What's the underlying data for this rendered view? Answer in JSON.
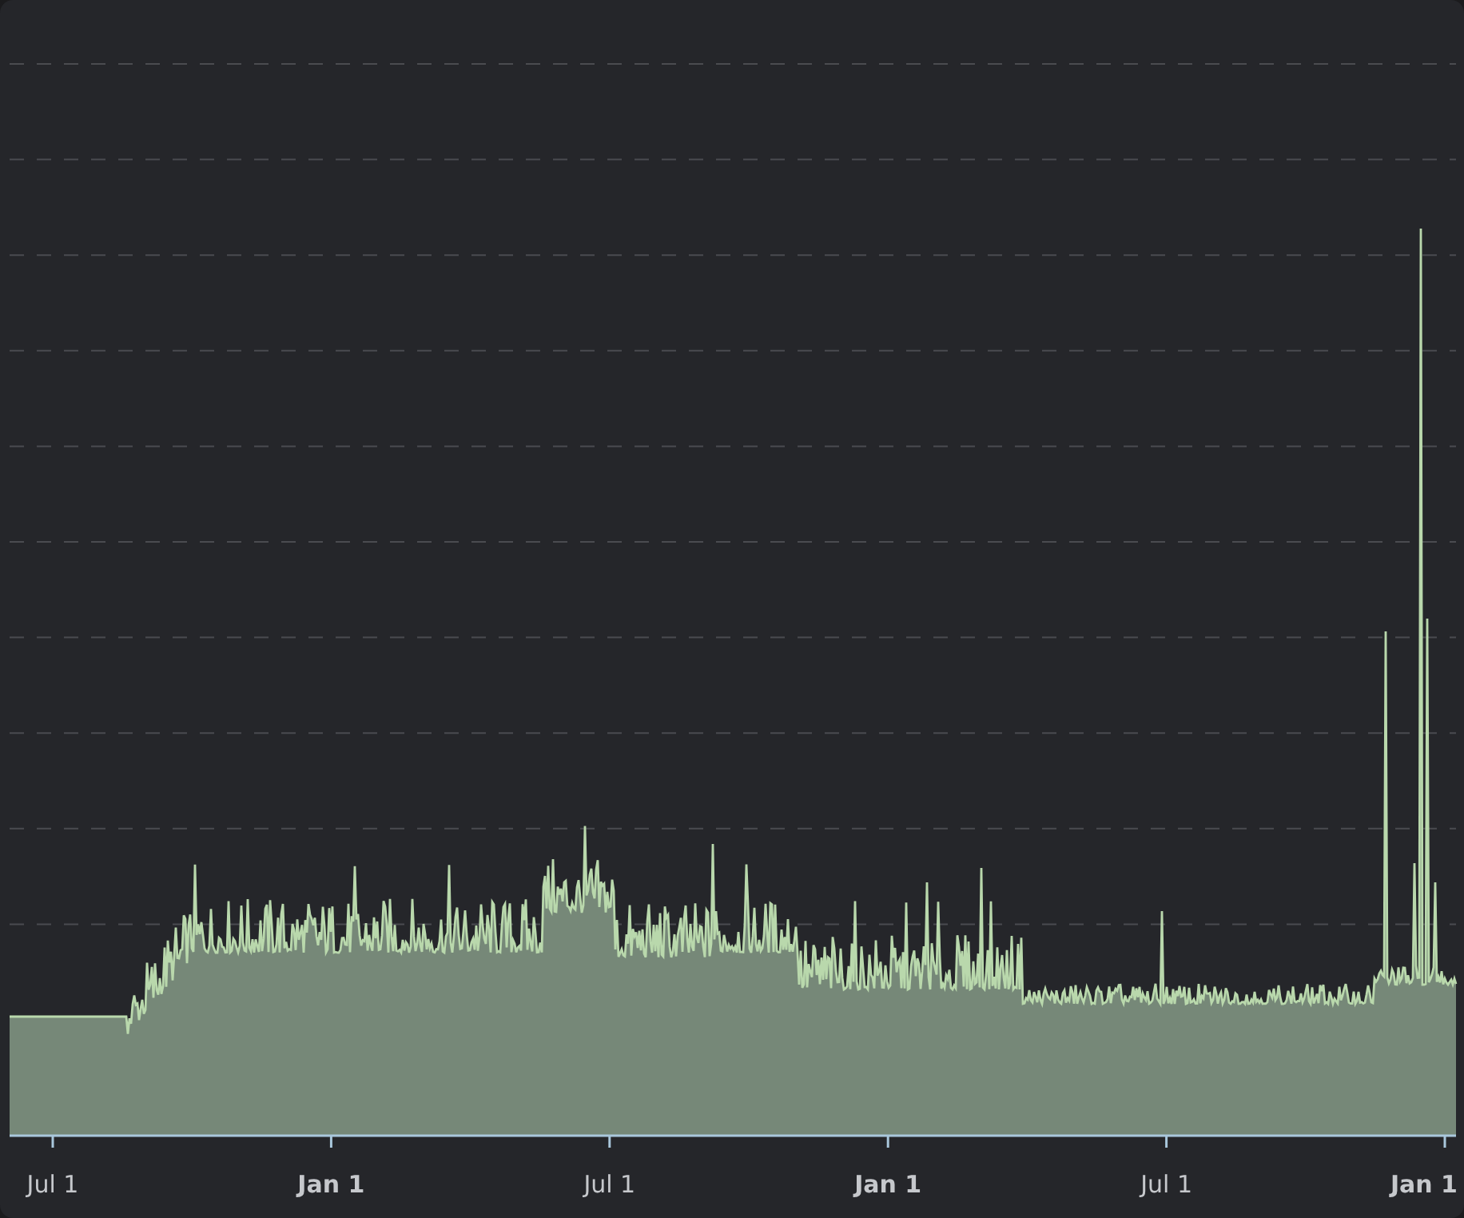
{
  "chart": {
    "x_tick_labels": [
      "Jul 1",
      "Jan 1",
      "Jul 1",
      "Jan 1",
      "Jul 1",
      "Jan 1"
    ]
  }
}
